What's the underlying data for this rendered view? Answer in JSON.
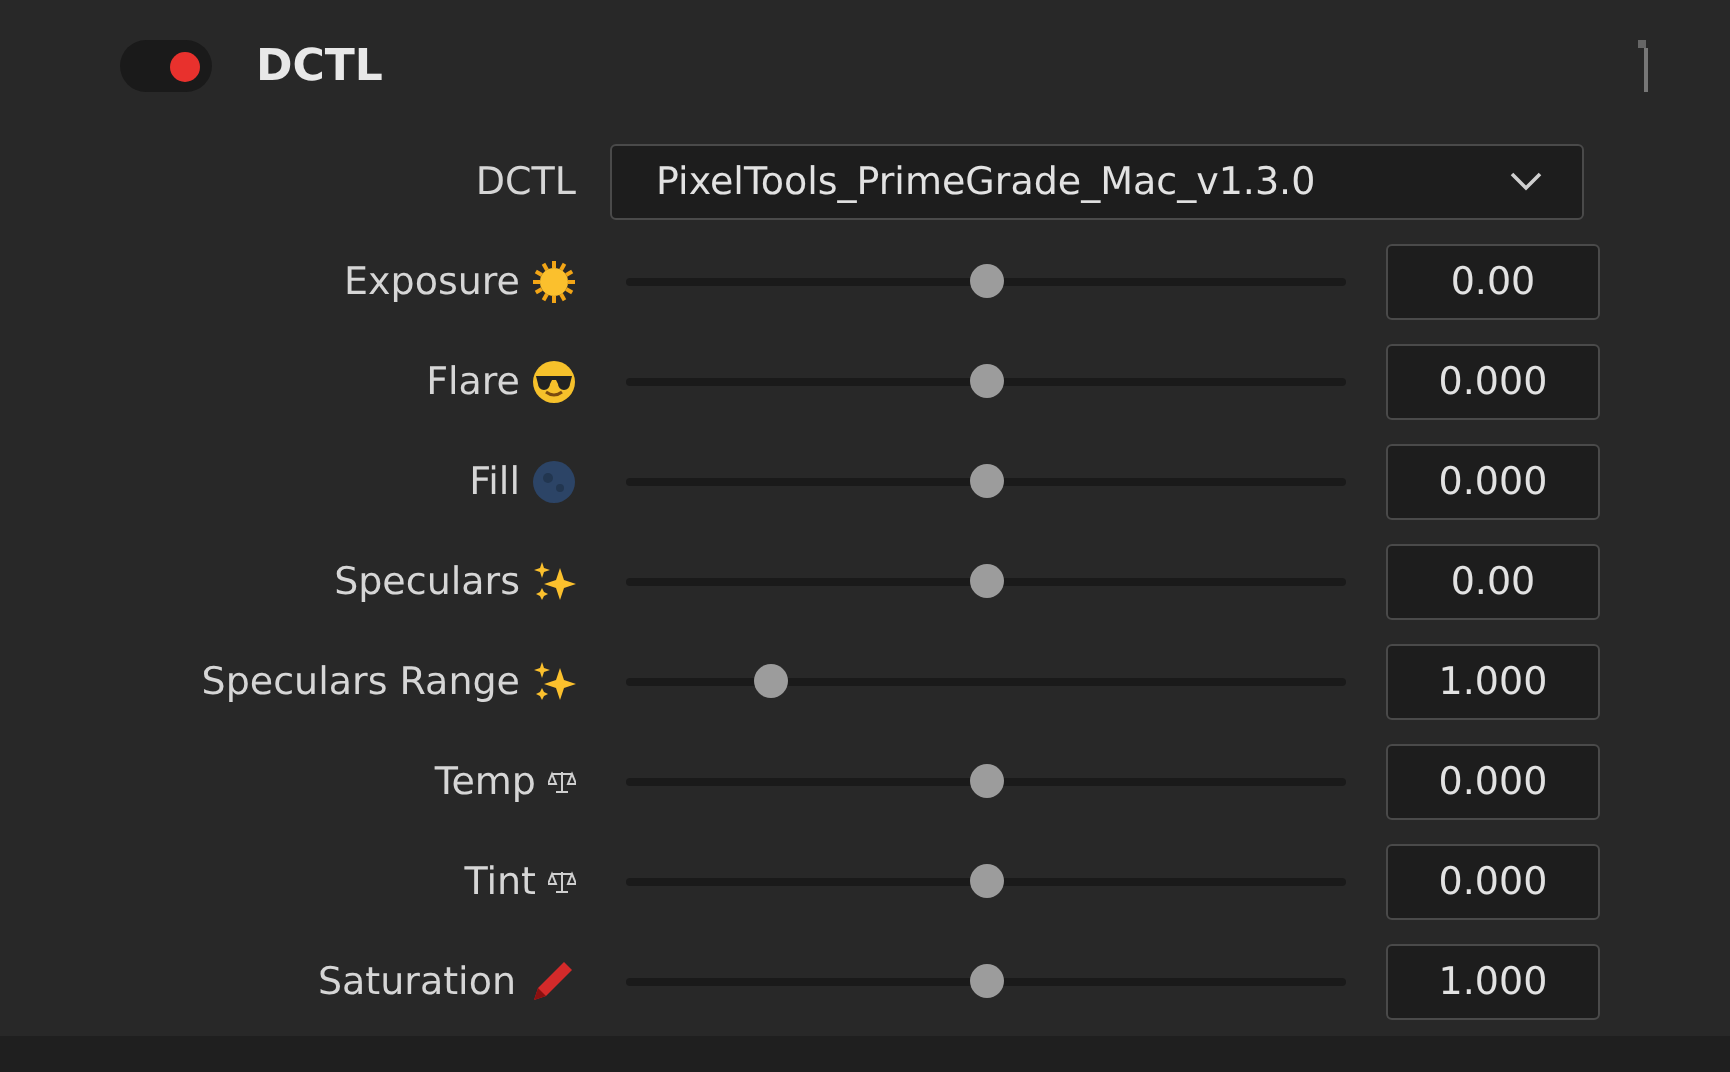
{
  "header": {
    "enabled": true,
    "title": "DCTL"
  },
  "dctl": {
    "label": "DCTL",
    "value": "PixelTools_PrimeGrade_Mac_v1.3.0"
  },
  "sliders": [
    {
      "label": "Exposure",
      "kind": "sun",
      "level": 0.5,
      "value": "0.00"
    },
    {
      "label": "Flare",
      "kind": "sunglasses",
      "level": 0.5,
      "value": "0.000"
    },
    {
      "label": "Fill",
      "kind": "moon",
      "level": 0.5,
      "value": "0.000"
    },
    {
      "label": "Speculars",
      "kind": "sparkles",
      "level": 0.5,
      "value": "0.00"
    },
    {
      "label": "Speculars Range",
      "kind": "sparkles",
      "level": 0.2,
      "value": "1.000"
    },
    {
      "label": "Temp",
      "kind": "scales",
      "level": 0.5,
      "value": "0.000"
    },
    {
      "label": "Tint",
      "kind": "scales",
      "level": 0.5,
      "value": "0.000"
    },
    {
      "label": "Saturation",
      "kind": "crayon",
      "level": 0.5,
      "value": "1.000"
    }
  ]
}
